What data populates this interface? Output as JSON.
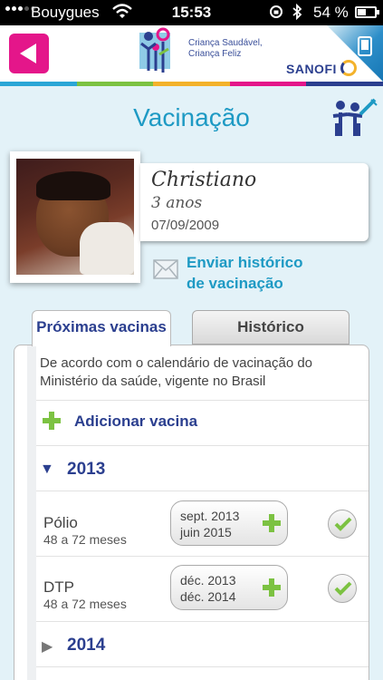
{
  "status_bar": {
    "carrier": "Bouygues",
    "time": "15:53",
    "battery": "54 %"
  },
  "header": {
    "brand_line1": "Criança Saudável,",
    "brand_line2": "Criança Feliz",
    "sponsor": "SANOFI",
    "stripe_colors": [
      "#2aa6d6",
      "#7cc242",
      "#f3b22b",
      "#e4168a",
      "#2b3f8f"
    ]
  },
  "page": {
    "title": "Vacinação"
  },
  "child": {
    "name": "Christiano",
    "age": "3 anos",
    "birth_date": "07/09/2009"
  },
  "actions": {
    "send_history_line1": "Enviar histórico",
    "send_history_line2": "de vacinação"
  },
  "tabs": {
    "next": "Próximas vacinas",
    "history": "Histórico"
  },
  "panel": {
    "note": "De acordo com o calendário de vacinação do Ministério da saúde, vigente no Brasil",
    "add_label": "Adicionar vacina",
    "years": [
      {
        "year": "2013",
        "expanded": true,
        "vaccines": [
          {
            "name": "Pólio",
            "range": "48 a 72 meses",
            "date1": "sept. 2013",
            "date2": "juin 2015",
            "done": true
          },
          {
            "name": "DTP",
            "range": "48 a 72 meses",
            "date1": "déc. 2013",
            "date2": "déc. 2014",
            "done": true
          }
        ]
      },
      {
        "year": "2014",
        "expanded": false
      }
    ]
  },
  "colors": {
    "accent_blue": "#1e9ac4",
    "navy": "#2b3f8f",
    "back_pink": "#e4168a",
    "plus_green": "#7cc242"
  }
}
